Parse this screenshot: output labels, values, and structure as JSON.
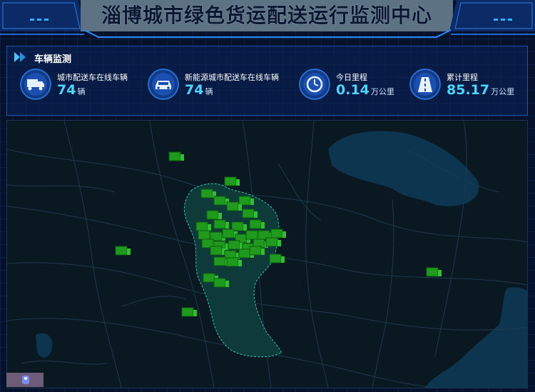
{
  "header": {
    "title": "淄博城市绿色货运配送运行监测中心"
  },
  "panel": {
    "title": "车辆监测"
  },
  "stats": [
    {
      "label": "城市配送车在线车辆",
      "value": "74",
      "unit": "辆",
      "icon": "truck-icon"
    },
    {
      "label": "新能源城市配送车在线车辆",
      "value": "74",
      "unit": "辆",
      "icon": "car-icon"
    },
    {
      "label": "今日里程",
      "value": "0.14",
      "unit": "万公里",
      "icon": "clock-icon"
    },
    {
      "label": "累计里程",
      "value": "85.17",
      "unit": "万公里",
      "icon": "road-icon"
    }
  ],
  "colors": {
    "accent": "#4fd3ff",
    "truck": "#1f9a1f",
    "map_bg": "#0a1822",
    "water": "#0e3550",
    "region_fill": "#0f3a3a",
    "region_border": "#33c4b4"
  }
}
